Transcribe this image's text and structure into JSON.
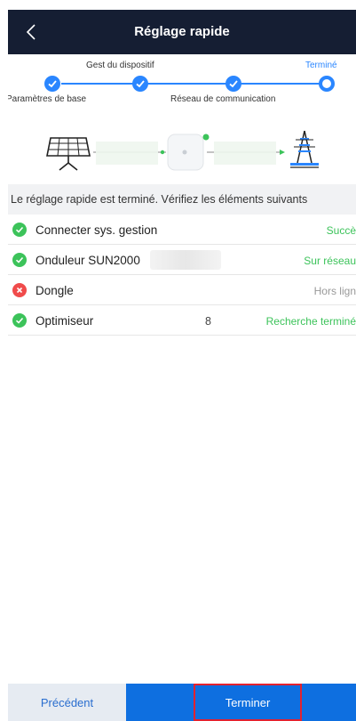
{
  "header": {
    "title": "Réglage rapide",
    "back_icon": "chevron-left-icon"
  },
  "steps": {
    "labels": [
      "Paramètres de base",
      "Gest du dispositif",
      "Réseau de communication",
      "Terminé"
    ],
    "completed": [
      true,
      true,
      true,
      false
    ],
    "current_index": 3
  },
  "diagram": {
    "icons": [
      "solar-panel-icon",
      "dongle-device-icon",
      "power-grid-tower-icon"
    ]
  },
  "notice": {
    "text": "Le réglage rapide est terminé. Vérifiez les éléments suivants"
  },
  "items": [
    {
      "name": "Connecter sys. gestion",
      "count": "",
      "status": "Succè",
      "state": "success"
    },
    {
      "name": "Onduleur SUN2000",
      "count": "",
      "status": "Sur réseau",
      "state": "success"
    },
    {
      "name": "Dongle",
      "count": "",
      "status": "Hors lign",
      "state": "error"
    },
    {
      "name": "Optimiseur",
      "count": "8",
      "status": "Recherche terminé",
      "state": "success"
    }
  ],
  "footer": {
    "previous_label": "Précédent",
    "finish_label": "Terminer"
  },
  "colors": {
    "header_bg": "#151e33",
    "accent": "#2a86ff",
    "success": "#3cc35a",
    "error": "#f04b4b",
    "finish_bg": "#0e6fe0",
    "highlight_border": "#e3222f"
  }
}
